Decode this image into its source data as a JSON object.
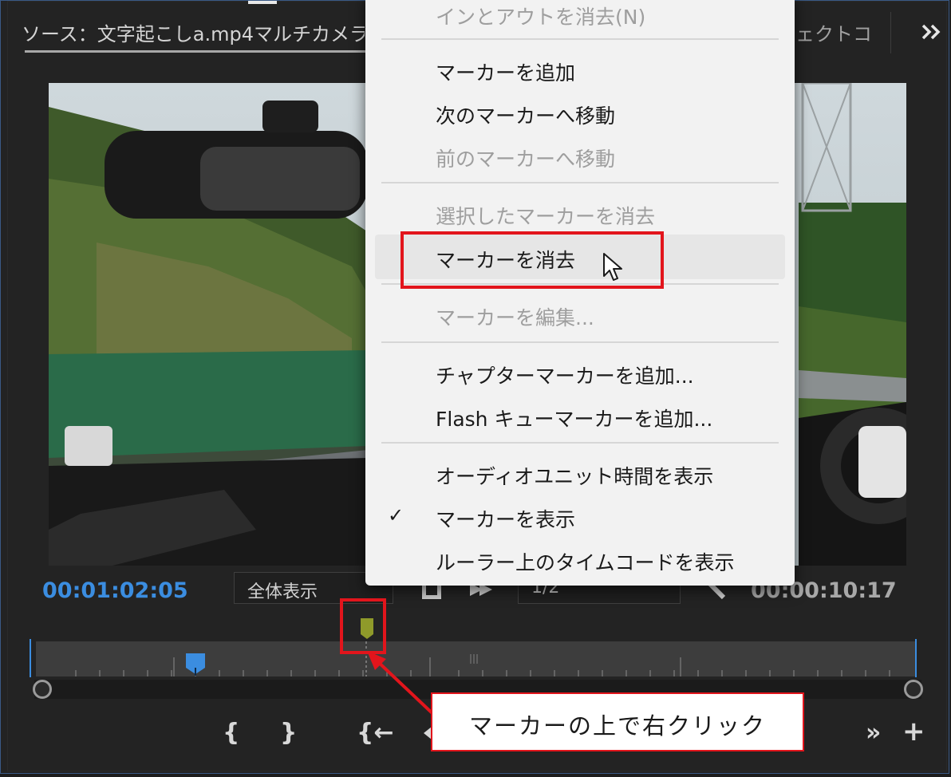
{
  "source_tab": {
    "title": "ソース：文字起こしa.mp4マルチカメラ",
    "right_label": "ェクトコンテ",
    "more_icon": "double-chevron-right-icon"
  },
  "timecodes": {
    "current": "00:01:02:05",
    "duration": "00:00:10:17"
  },
  "zoom": {
    "selected": "全体表示"
  },
  "resolution": {
    "selected": "1/2"
  },
  "context_menu": {
    "items": [
      {
        "label": "インとアウトを消去(N)",
        "enabled": false,
        "checked": false
      },
      {
        "label": "マーカーを追加",
        "enabled": true,
        "checked": false
      },
      {
        "label": "次のマーカーへ移動",
        "enabled": true,
        "checked": false
      },
      {
        "label": "前のマーカーへ移動",
        "enabled": false,
        "checked": false
      },
      {
        "label": "選択したマーカーを消去",
        "enabled": false,
        "checked": false
      },
      {
        "label": "マーカーを消去",
        "enabled": true,
        "checked": false,
        "hovered": true
      },
      {
        "label": "マーカーを編集...",
        "enabled": false,
        "checked": false
      },
      {
        "label": "チャプターマーカーを追加...",
        "enabled": true,
        "checked": false
      },
      {
        "label": "Flash キューマーカーを追加...",
        "enabled": true,
        "checked": false
      },
      {
        "label": "オーディオユニット時間を表示",
        "enabled": true,
        "checked": false
      },
      {
        "label": "マーカーを表示",
        "enabled": true,
        "checked": true
      },
      {
        "label": "ルーラー上のタイムコードを表示",
        "enabled": true,
        "checked": false
      }
    ],
    "check_glyph": "✓"
  },
  "transport": {
    "mark_in": "{",
    "mark_out": "}",
    "go_to_in": "{←",
    "overflow": "»",
    "add": "+"
  },
  "annotation": {
    "callout_text": "マーカーの上で右クリック",
    "highlight_color": "#e2151c"
  },
  "colors": {
    "timecode_current": "#3b8de0",
    "playhead": "#3b8de0",
    "marker": "#8f9a2a"
  }
}
